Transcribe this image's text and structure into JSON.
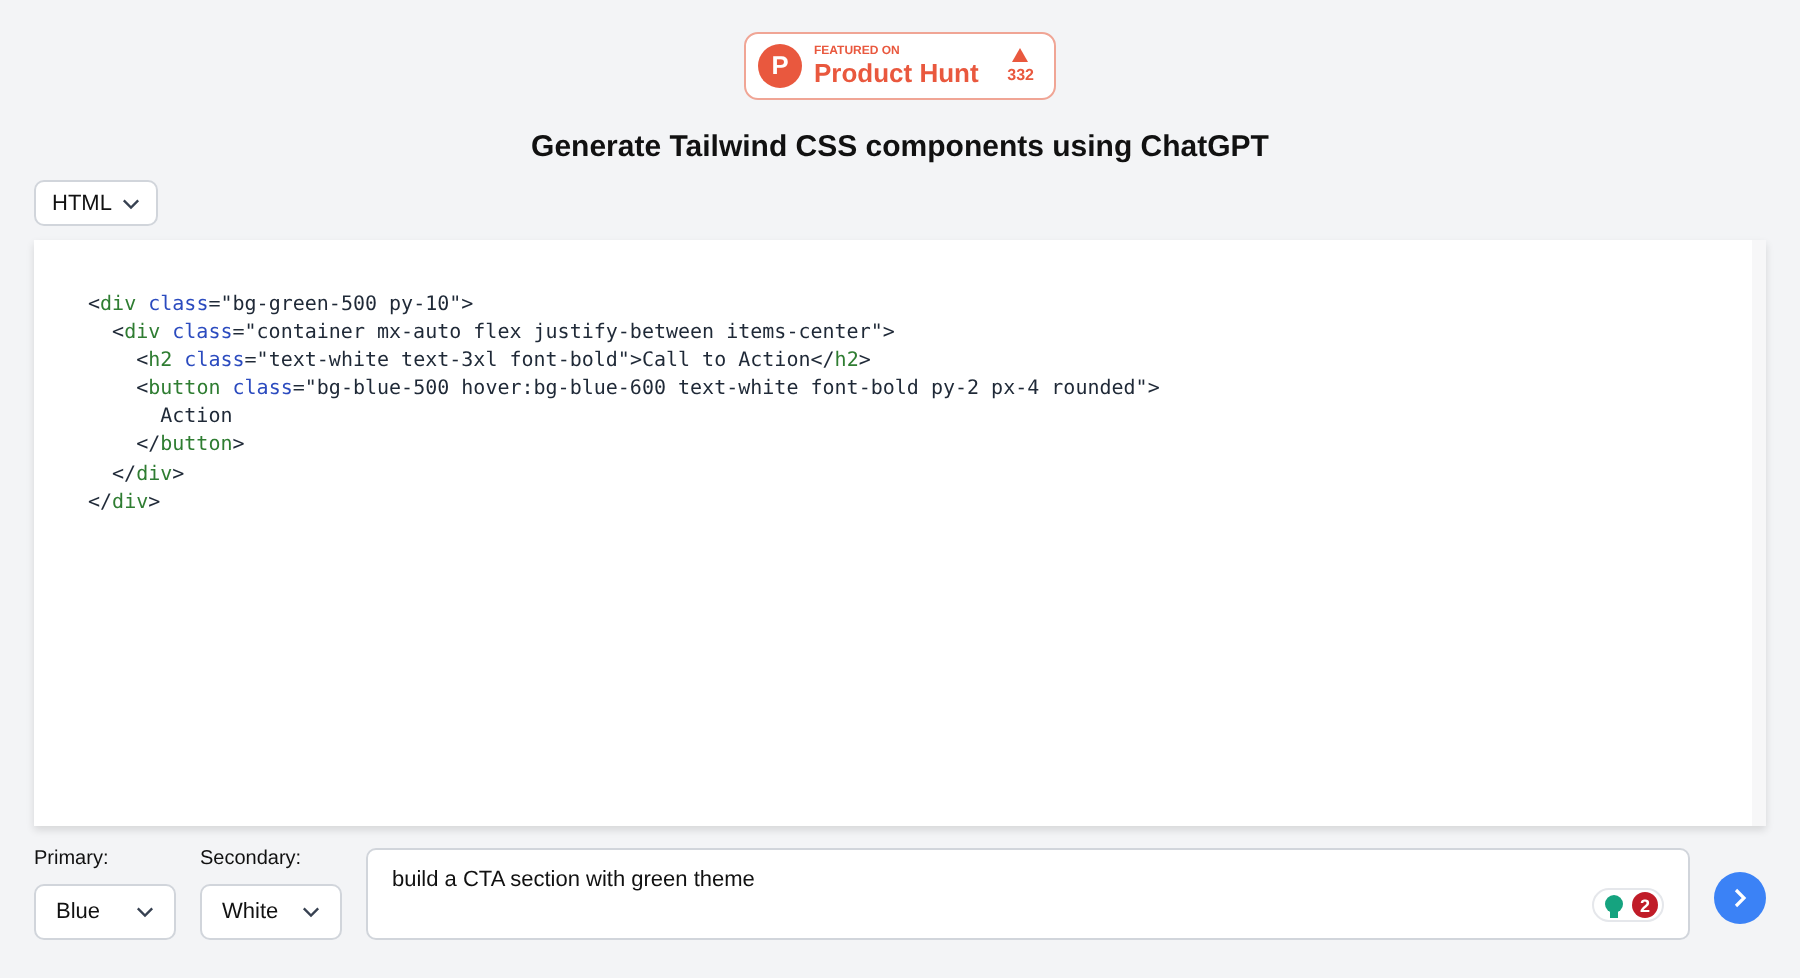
{
  "badge": {
    "featured": "FEATURED ON",
    "name": "Product Hunt",
    "votes": "332",
    "logo_letter": "P"
  },
  "title": "Generate Tailwind CSS components using ChatGPT",
  "format_select": {
    "value": "HTML"
  },
  "code_lines": [
    [
      {
        "kind": "text",
        "text": "<"
      },
      {
        "kind": "tag",
        "text": "div"
      },
      {
        "kind": "attr",
        "text": " class"
      },
      {
        "kind": "text",
        "text": "=\"bg-green-500 py-10\">"
      }
    ],
    [
      {
        "kind": "text",
        "text": "  <"
      },
      {
        "kind": "tag",
        "text": "div"
      },
      {
        "kind": "attr",
        "text": " class"
      },
      {
        "kind": "text",
        "text": "=\"container mx-auto flex justify-between items-center\">"
      }
    ],
    [
      {
        "kind": "text",
        "text": "    <"
      },
      {
        "kind": "tag",
        "text": "h2"
      },
      {
        "kind": "attr",
        "text": " class"
      },
      {
        "kind": "text",
        "text": "=\"text-white text-3xl font-bold\">Call to Action</"
      },
      {
        "kind": "tag",
        "text": "h2"
      },
      {
        "kind": "text",
        "text": ">"
      }
    ],
    [
      {
        "kind": "text",
        "text": "    <"
      },
      {
        "kind": "tag",
        "text": "button"
      },
      {
        "kind": "attr",
        "text": " class"
      },
      {
        "kind": "text",
        "text": "=\"bg-blue-500 hover:bg-blue-600 text-white font-bold py-2 px-4 rounded\">"
      }
    ],
    [
      {
        "kind": "text",
        "text": "      Action"
      }
    ],
    [
      {
        "kind": "text",
        "text": "    </"
      },
      {
        "kind": "tag",
        "text": "button"
      },
      {
        "kind": "text",
        "text": ">"
      }
    ],
    [
      {
        "kind": "text",
        "text": "  </"
      },
      {
        "kind": "tag",
        "text": "div"
      },
      {
        "kind": "text",
        "text": ">"
      }
    ],
    [
      {
        "kind": "text",
        "text": "</"
      },
      {
        "kind": "tag",
        "text": "div"
      },
      {
        "kind": "text",
        "text": ">"
      }
    ]
  ],
  "primary": {
    "label": "Primary:",
    "value": "Blue"
  },
  "secondary": {
    "label": "Secondary:",
    "value": "White"
  },
  "prompt": {
    "value": "build a CTA section with green theme",
    "issues": "2"
  }
}
